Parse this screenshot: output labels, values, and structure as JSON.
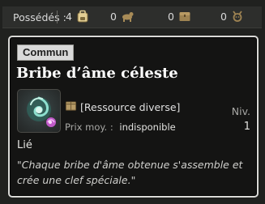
{
  "owned": {
    "label": "Possédés :",
    "groups": [
      {
        "count": "4",
        "icon": "backpack-icon"
      },
      {
        "count": "0",
        "icon": "mount-icon"
      },
      {
        "count": "0",
        "icon": "chest-icon"
      },
      {
        "count": "0",
        "icon": "pet-icon"
      }
    ]
  },
  "item": {
    "rarity": "Commun",
    "name": "Bribe d’âme céleste",
    "icon": "celestial-soul-shard-icon",
    "type_icon": "resource-crate-icon",
    "type": "[Ressource diverse]",
    "price_label": "Prix moy. :",
    "price_value": "indisponible",
    "level_label": "Niv.",
    "level_value": "1",
    "bound": "Lié",
    "description": "\"Chaque bribe d'âme obtenue s'assemble et crée une clef spéciale.\""
  },
  "colors": {
    "tooltip_border": "#d9d9d6",
    "tooltip_bg": "#141413",
    "rarity_badge_bg": "#d9d9d9",
    "bar_bg": "#2d2e2c"
  }
}
